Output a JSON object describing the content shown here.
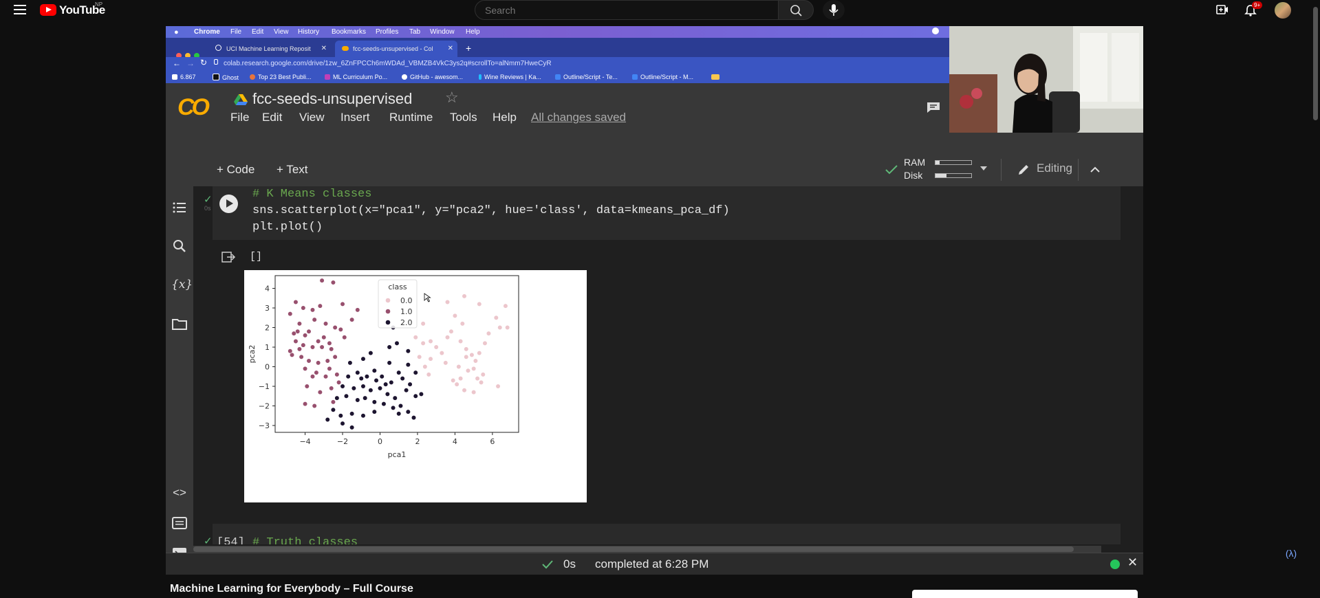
{
  "youtube": {
    "logo_text": "YouTube",
    "country": "NP",
    "search_placeholder": "Search",
    "notification_badge": "9+",
    "video_title": "Machine Learning for Everybody – Full Course"
  },
  "mac_menu": [
    "Chrome",
    "File",
    "Edit",
    "View",
    "History",
    "Bookmarks",
    "Profiles",
    "Tab",
    "Window",
    "Help"
  ],
  "browser": {
    "tabs": [
      {
        "label": "UCI Machine Learning Reposit"
      },
      {
        "label": "fcc-seeds-unsupervised - Col"
      }
    ],
    "url": "colab.research.google.com/drive/1zw_6ZnFPCCh6mWDAd_VBMZB4VkC3ys2q#scrollTo=alNmm7HweCyR",
    "bookmarks": [
      "6.867",
      "Ghost",
      "Top 23 Best Publi...",
      "ML Curriculum Po...",
      "GitHub - awesom...",
      "Wine Reviews | Ka...",
      "Outline/Script - Te...",
      "Outline/Script - M..."
    ]
  },
  "colab": {
    "logo": "CO",
    "notebook_title": "fcc-seeds-unsupervised",
    "menu": [
      "File",
      "Edit",
      "View",
      "Insert",
      "Runtime",
      "Tools",
      "Help"
    ],
    "save_status": "All changes saved",
    "add_code": "+ Code",
    "add_text": "+ Text",
    "ram_label": "RAM",
    "disk_label": "Disk",
    "ram_fill": 0.12,
    "disk_fill": 0.3,
    "editing_label": "Editing",
    "cell1": {
      "exec_time": "0s",
      "lines": [
        "# K Means classes",
        "sns.scatterplot(x=\"pca1\", y=\"pca2\", hue='class', data=kmeans_pca_df)",
        "plt.plot()"
      ],
      "output_text": "[]"
    },
    "cell2": {
      "exec_count": "[54]",
      "comment": "# Truth classes"
    },
    "status": {
      "exec_time": "0s",
      "text": "completed at 6:28 PM"
    }
  },
  "chart_data": {
    "type": "scatter",
    "xlabel": "pca1",
    "ylabel": "pca2",
    "xlim": [
      -5.6,
      7.4
    ],
    "ylim": [
      -3.35,
      4.65
    ],
    "xticks": [
      -4,
      -2,
      0,
      2,
      4,
      6
    ],
    "xtick_labels": [
      "−4",
      "−2",
      "0",
      "2",
      "4",
      "6"
    ],
    "yticks": [
      -3,
      -2,
      -1,
      0,
      1,
      2,
      3,
      4
    ],
    "ytick_labels": [
      "−3",
      "−2",
      "−1",
      "0",
      "1",
      "2",
      "3",
      "4"
    ],
    "legend": {
      "title": "class",
      "placement": "top-center",
      "entries": [
        "0.0",
        "1.0",
        "2.0"
      ]
    },
    "colors": [
      "#ecc6cc",
      "#98506e",
      "#1d1530"
    ],
    "series": [
      {
        "name": "0.0",
        "points": [
          [
            4.5,
            3.6
          ],
          [
            3.6,
            3.3
          ],
          [
            5.3,
            3.2
          ],
          [
            6.7,
            3.1
          ],
          [
            4.0,
            2.6
          ],
          [
            4.4,
            2.2
          ],
          [
            2.3,
            2.2
          ],
          [
            1.9,
            1.5
          ],
          [
            2.7,
            1.3
          ],
          [
            3.0,
            1.0
          ],
          [
            3.3,
            0.7
          ],
          [
            2.1,
            0.5
          ],
          [
            2.7,
            0.4
          ],
          [
            4.6,
            0.5
          ],
          [
            4.9,
            0.6
          ],
          [
            5.3,
            0.7
          ],
          [
            4.2,
            0.0
          ],
          [
            4.7,
            -0.2
          ],
          [
            3.9,
            -0.7
          ],
          [
            5.4,
            -0.8
          ],
          [
            4.1,
            -0.9
          ],
          [
            4.5,
            -1.2
          ],
          [
            5.0,
            -1.3
          ],
          [
            6.3,
            -1.0
          ],
          [
            2.4,
            0.0
          ],
          [
            2.6,
            -0.4
          ],
          [
            3.6,
            1.5
          ],
          [
            5.8,
            1.7
          ],
          [
            6.4,
            2.0
          ],
          [
            6.8,
            2.0
          ],
          [
            3.8,
            1.8
          ],
          [
            4.3,
            1.3
          ],
          [
            5.6,
            1.2
          ],
          [
            5.0,
            -0.1
          ],
          [
            4.6,
            0.9
          ],
          [
            5.5,
            -0.4
          ],
          [
            3.5,
            0.2
          ],
          [
            5.1,
            0.3
          ],
          [
            6.2,
            2.5
          ],
          [
            2.3,
            1.2
          ],
          [
            5.2,
            -0.6
          ],
          [
            4.3,
            -0.6
          ]
        ]
      },
      {
        "name": "1.0",
        "points": [
          [
            -3.1,
            4.4
          ],
          [
            -2.5,
            4.3
          ],
          [
            -4.5,
            3.3
          ],
          [
            -4.1,
            3.0
          ],
          [
            -3.6,
            2.9
          ],
          [
            -3.2,
            3.1
          ],
          [
            -2.0,
            3.2
          ],
          [
            -1.2,
            2.9
          ],
          [
            -1.5,
            2.4
          ],
          [
            -4.8,
            2.7
          ],
          [
            -4.3,
            2.2
          ],
          [
            -3.5,
            2.4
          ],
          [
            -2.9,
            2.2
          ],
          [
            -2.4,
            2.0
          ],
          [
            -4.4,
            1.8
          ],
          [
            -4.0,
            1.6
          ],
          [
            -3.0,
            1.5
          ],
          [
            -2.7,
            1.2
          ],
          [
            -4.5,
            1.3
          ],
          [
            -4.1,
            1.1
          ],
          [
            -3.6,
            1.0
          ],
          [
            -3.1,
            1.0
          ],
          [
            -2.6,
            0.9
          ],
          [
            -4.7,
            0.6
          ],
          [
            -4.2,
            0.5
          ],
          [
            -3.8,
            0.3
          ],
          [
            -3.3,
            0.2
          ],
          [
            -2.8,
            0.3
          ],
          [
            -2.4,
            0.5
          ],
          [
            -4.0,
            -0.1
          ],
          [
            -3.4,
            -0.3
          ],
          [
            -2.9,
            -0.5
          ],
          [
            -2.3,
            -0.4
          ],
          [
            -3.9,
            -1.0
          ],
          [
            -3.2,
            -1.3
          ],
          [
            -2.6,
            -1.1
          ],
          [
            -4.0,
            -1.9
          ],
          [
            -3.5,
            -2.0
          ],
          [
            -2.5,
            -1.8
          ],
          [
            -4.8,
            0.8
          ],
          [
            -4.6,
            1.7
          ],
          [
            -3.8,
            1.8
          ],
          [
            -2.1,
            1.9
          ],
          [
            -1.9,
            1.5
          ],
          [
            -3.3,
            1.3
          ],
          [
            -4.3,
            0.9
          ],
          [
            -2.7,
            -0.1
          ],
          [
            -3.6,
            -0.5
          ],
          [
            -2.2,
            -0.8
          ]
        ]
      },
      {
        "name": "2.0",
        "points": [
          [
            0.7,
            2.0
          ],
          [
            0.5,
            1.0
          ],
          [
            0.9,
            1.2
          ],
          [
            1.5,
            0.8
          ],
          [
            -0.5,
            0.7
          ],
          [
            -0.9,
            0.4
          ],
          [
            -1.6,
            0.2
          ],
          [
            -1.2,
            -0.3
          ],
          [
            -0.7,
            -0.5
          ],
          [
            -0.3,
            -0.2
          ],
          [
            0.1,
            -0.5
          ],
          [
            0.6,
            -0.8
          ],
          [
            1.0,
            -0.3
          ],
          [
            1.5,
            0.1
          ],
          [
            1.9,
            -0.3
          ],
          [
            -1.7,
            -0.5
          ],
          [
            -2.0,
            -1.0
          ],
          [
            -1.4,
            -1.1
          ],
          [
            -0.9,
            -1.0
          ],
          [
            -0.5,
            -1.2
          ],
          [
            0.0,
            -1.1
          ],
          [
            0.4,
            -1.4
          ],
          [
            0.8,
            -1.6
          ],
          [
            1.4,
            -1.2
          ],
          [
            1.9,
            -1.5
          ],
          [
            2.2,
            -1.4
          ],
          [
            -2.3,
            -1.6
          ],
          [
            -1.8,
            -1.5
          ],
          [
            -1.2,
            -1.7
          ],
          [
            -0.8,
            -1.6
          ],
          [
            -0.3,
            -1.8
          ],
          [
            0.2,
            -1.9
          ],
          [
            0.7,
            -2.1
          ],
          [
            1.1,
            -2.0
          ],
          [
            1.5,
            -2.3
          ],
          [
            1.8,
            -2.6
          ],
          [
            -2.5,
            -2.2
          ],
          [
            -2.1,
            -2.5
          ],
          [
            -1.5,
            -2.4
          ],
          [
            -0.9,
            -2.5
          ],
          [
            -0.3,
            -2.3
          ],
          [
            -2.8,
            -2.7
          ],
          [
            -2.0,
            -2.9
          ],
          [
            -1.5,
            -3.1
          ],
          [
            -0.2,
            -0.7
          ],
          [
            0.3,
            -0.9
          ],
          [
            -1.0,
            -0.6
          ],
          [
            1.2,
            -0.6
          ],
          [
            0.5,
            0.2
          ],
          [
            1.6,
            -0.9
          ],
          [
            1.0,
            -2.4
          ]
        ]
      }
    ]
  }
}
